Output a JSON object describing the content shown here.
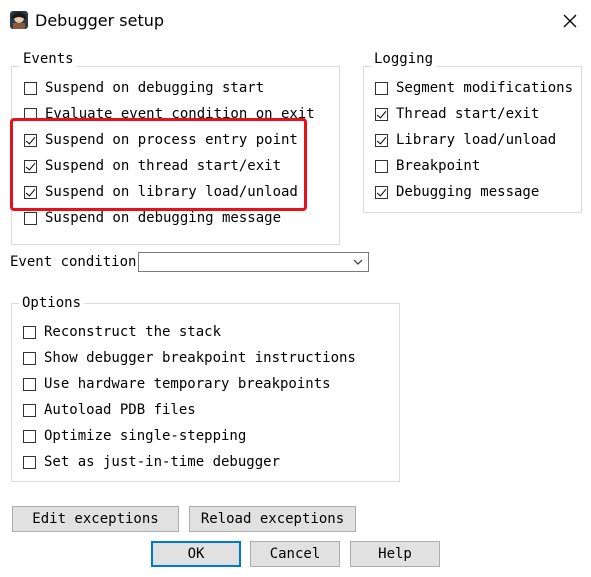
{
  "window": {
    "title": "Debugger setup"
  },
  "events": {
    "title": "Events",
    "items": [
      {
        "label": "Suspend on debugging start",
        "checked": false
      },
      {
        "label": "Evaluate event condition on exit",
        "checked": false
      },
      {
        "label": "Suspend on process entry point",
        "checked": true
      },
      {
        "label": "Suspend on thread start/exit",
        "checked": true
      },
      {
        "label": "Suspend on library load/unload",
        "checked": true
      },
      {
        "label": "Suspend on debugging message",
        "checked": false
      }
    ]
  },
  "logging": {
    "title": "Logging",
    "items": [
      {
        "label": "Segment modifications",
        "checked": false
      },
      {
        "label": "Thread start/exit",
        "checked": true
      },
      {
        "label": "Library load/unload",
        "checked": true
      },
      {
        "label": "Breakpoint",
        "checked": false
      },
      {
        "label": "Debugging message",
        "checked": true
      }
    ]
  },
  "event_condition": {
    "label": "Event condition",
    "value": ""
  },
  "options": {
    "title": "Options",
    "items": [
      {
        "label": "Reconstruct the stack",
        "checked": false
      },
      {
        "label": "Show debugger breakpoint instructions",
        "checked": false
      },
      {
        "label": "Use hardware temporary breakpoints",
        "checked": false
      },
      {
        "label": "Autoload PDB files",
        "checked": false
      },
      {
        "label": "Optimize single-stepping",
        "checked": false
      },
      {
        "label": "Set as just-in-time debugger",
        "checked": false
      }
    ]
  },
  "buttons": {
    "edit_exceptions": "Edit exceptions",
    "reload_exceptions": "Reload exceptions",
    "ok": "OK",
    "cancel": "Cancel",
    "help": "Help"
  },
  "colors": {
    "highlight": "#e8101a",
    "default_button_border": "#0078d7"
  },
  "icons": {
    "app": "ida-app-icon",
    "close": "close-icon",
    "combo_arrow": "chevron-down-icon"
  }
}
